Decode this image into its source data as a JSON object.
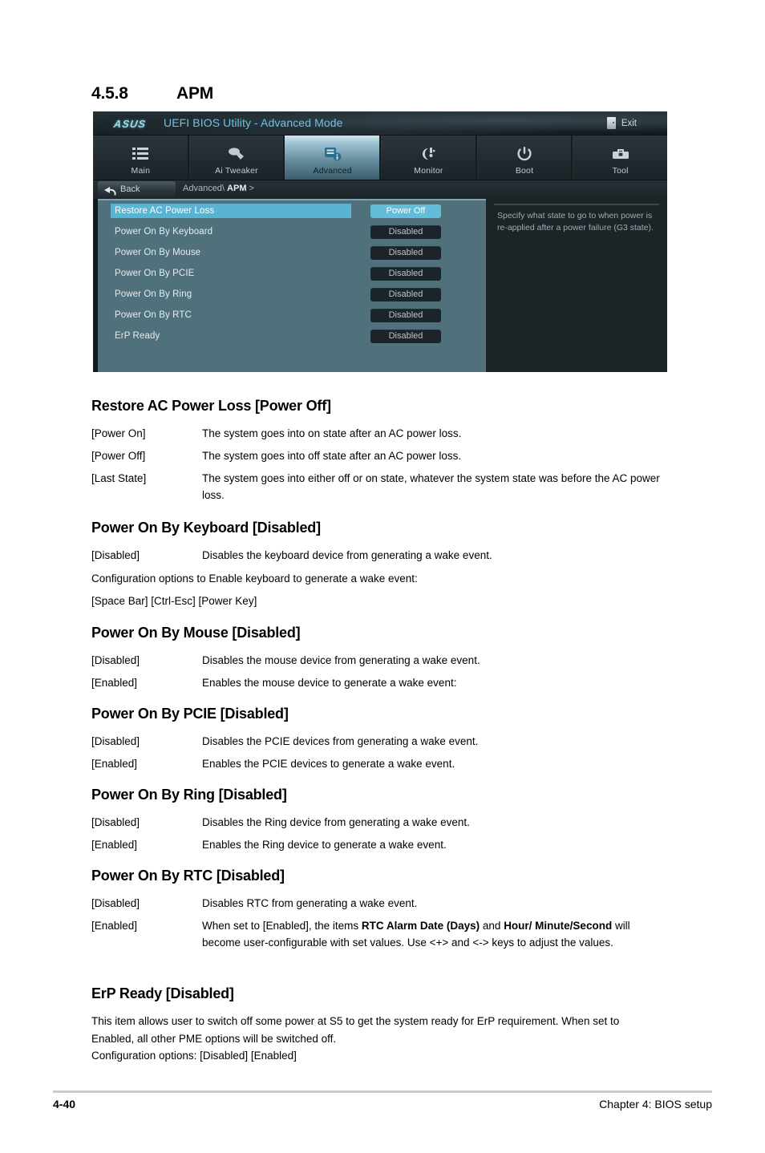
{
  "section": {
    "number": "4.5.8",
    "title": "APM"
  },
  "bios": {
    "logo": "ASUS",
    "title": "UEFI BIOS Utility - Advanced Mode",
    "exit_label": "Exit",
    "tabs": [
      {
        "label": "Main",
        "icon": "list-icon",
        "active": false
      },
      {
        "label": "Ai  Tweaker",
        "icon": "tuner-icon",
        "active": false
      },
      {
        "label": "Advanced",
        "icon": "chip-icon",
        "active": true
      },
      {
        "label": "Monitor",
        "icon": "fan-icon",
        "active": false
      },
      {
        "label": "Boot",
        "icon": "power-icon",
        "active": false
      },
      {
        "label": "Tool",
        "icon": "toolbox-icon",
        "active": false
      }
    ],
    "back_label": "Back",
    "breadcrumb_prefix": "Advanced\\ ",
    "breadcrumb_current": "APM",
    "breadcrumb_suffix": " >",
    "items": [
      {
        "label": "Restore AC Power Loss",
        "value": "Power Off",
        "selected": true
      },
      {
        "label": "Power On By Keyboard",
        "value": "Disabled",
        "selected": false
      },
      {
        "label": "Power On By Mouse",
        "value": "Disabled",
        "selected": false
      },
      {
        "label": "Power On By PCIE",
        "value": "Disabled",
        "selected": false
      },
      {
        "label": "Power On By Ring",
        "value": "Disabled",
        "selected": false
      },
      {
        "label": "Power On By RTC",
        "value": "Disabled",
        "selected": false
      },
      {
        "label": "ErP Ready",
        "value": "Disabled",
        "selected": false
      }
    ],
    "help_text": "Specify what state to go to when power is re-applied after a power failure (G3 state).",
    "colors": {
      "selection_blue": "#59b4d4",
      "panel_teal": "#50707b",
      "dark_bg": "#1c2428",
      "title_cyan": "#6fc3e0"
    }
  },
  "doc": {
    "s1": {
      "heading": "Restore AC Power Loss [Power Off]",
      "rows": [
        {
          "term": "[Power On]",
          "desc": "The system goes into on state after an AC power loss."
        },
        {
          "term": "[Power Off]",
          "desc": "The system goes into off state after an AC power loss."
        },
        {
          "term": "[Last State]",
          "desc": "The system goes into either off or on state, whatever the system state was before the AC power loss."
        }
      ]
    },
    "s2": {
      "heading": "Power On By Keyboard [Disabled]",
      "rows": [
        {
          "term": "[Disabled]",
          "desc": "Disables the keyboard device from generating a wake event."
        }
      ],
      "line1": "Configuration options to Enable keyboard to generate a wake event:",
      "line2": "[Space Bar] [Ctrl-Esc] [Power Key]"
    },
    "s3": {
      "heading": "Power On By Mouse [Disabled]",
      "rows": [
        {
          "term": "[Disabled]",
          "desc": "Disables the mouse device from generating a wake event."
        },
        {
          "term": "[Enabled]",
          "desc": "Enables the mouse device to generate a wake event:"
        }
      ]
    },
    "s4": {
      "heading": "Power On By PCIE [Disabled]",
      "rows": [
        {
          "term": "[Disabled]",
          "desc": "Disables the PCIE devices from generating a wake event."
        },
        {
          "term": "[Enabled]",
          "desc": "Enables the PCIE devices to generate a wake event."
        }
      ]
    },
    "s5": {
      "heading": "Power On By Ring [Disabled]",
      "rows": [
        {
          "term": "[Disabled]",
          "desc": "Disables the Ring device from generating a wake event."
        },
        {
          "term": "[Enabled]",
          "desc": "Enables the Ring device to generate a wake event."
        }
      ]
    },
    "s6": {
      "heading": "Power On By RTC [Disabled]",
      "row1_term": "[Disabled]",
      "row1_desc": "Disables RTC from generating a wake event.",
      "row2_term": "[Enabled]",
      "row2_a": "When set to [Enabled], the items ",
      "row2_b": "RTC Alarm Date (Days)",
      "row2_c": " and ",
      "row2_d": "Hour/ Minute/Second",
      "row2_e": " will become user-configurable with set values. Use <+> and <-> keys to adjust the values."
    },
    "s7": {
      "heading": "ErP Ready [Disabled]",
      "line1": "This item allows user to switch off some power at S5 to get the system ready for ErP requirement. When set to Enabled, all other PME options will be switched off.",
      "line2": "Configuration options: [Disabled] [Enabled]"
    }
  },
  "footer": {
    "page": "4-40",
    "chapter": "Chapter 4: BIOS setup"
  }
}
